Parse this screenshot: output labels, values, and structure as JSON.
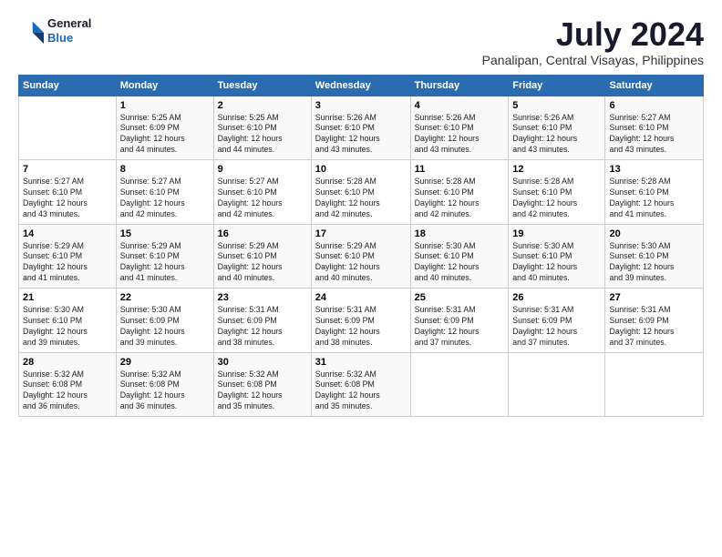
{
  "logo": {
    "line1": "General",
    "line2": "Blue"
  },
  "title": "July 2024",
  "subtitle": "Panalipan, Central Visayas, Philippines",
  "days_of_week": [
    "Sunday",
    "Monday",
    "Tuesday",
    "Wednesday",
    "Thursday",
    "Friday",
    "Saturday"
  ],
  "weeks": [
    [
      {
        "num": "",
        "info": ""
      },
      {
        "num": "1",
        "info": "Sunrise: 5:25 AM\nSunset: 6:09 PM\nDaylight: 12 hours\nand 44 minutes."
      },
      {
        "num": "2",
        "info": "Sunrise: 5:25 AM\nSunset: 6:10 PM\nDaylight: 12 hours\nand 44 minutes."
      },
      {
        "num": "3",
        "info": "Sunrise: 5:26 AM\nSunset: 6:10 PM\nDaylight: 12 hours\nand 43 minutes."
      },
      {
        "num": "4",
        "info": "Sunrise: 5:26 AM\nSunset: 6:10 PM\nDaylight: 12 hours\nand 43 minutes."
      },
      {
        "num": "5",
        "info": "Sunrise: 5:26 AM\nSunset: 6:10 PM\nDaylight: 12 hours\nand 43 minutes."
      },
      {
        "num": "6",
        "info": "Sunrise: 5:27 AM\nSunset: 6:10 PM\nDaylight: 12 hours\nand 43 minutes."
      }
    ],
    [
      {
        "num": "7",
        "info": "Sunrise: 5:27 AM\nSunset: 6:10 PM\nDaylight: 12 hours\nand 43 minutes."
      },
      {
        "num": "8",
        "info": "Sunrise: 5:27 AM\nSunset: 6:10 PM\nDaylight: 12 hours\nand 42 minutes."
      },
      {
        "num": "9",
        "info": "Sunrise: 5:27 AM\nSunset: 6:10 PM\nDaylight: 12 hours\nand 42 minutes."
      },
      {
        "num": "10",
        "info": "Sunrise: 5:28 AM\nSunset: 6:10 PM\nDaylight: 12 hours\nand 42 minutes."
      },
      {
        "num": "11",
        "info": "Sunrise: 5:28 AM\nSunset: 6:10 PM\nDaylight: 12 hours\nand 42 minutes."
      },
      {
        "num": "12",
        "info": "Sunrise: 5:28 AM\nSunset: 6:10 PM\nDaylight: 12 hours\nand 42 minutes."
      },
      {
        "num": "13",
        "info": "Sunrise: 5:28 AM\nSunset: 6:10 PM\nDaylight: 12 hours\nand 41 minutes."
      }
    ],
    [
      {
        "num": "14",
        "info": "Sunrise: 5:29 AM\nSunset: 6:10 PM\nDaylight: 12 hours\nand 41 minutes."
      },
      {
        "num": "15",
        "info": "Sunrise: 5:29 AM\nSunset: 6:10 PM\nDaylight: 12 hours\nand 41 minutes."
      },
      {
        "num": "16",
        "info": "Sunrise: 5:29 AM\nSunset: 6:10 PM\nDaylight: 12 hours\nand 40 minutes."
      },
      {
        "num": "17",
        "info": "Sunrise: 5:29 AM\nSunset: 6:10 PM\nDaylight: 12 hours\nand 40 minutes."
      },
      {
        "num": "18",
        "info": "Sunrise: 5:30 AM\nSunset: 6:10 PM\nDaylight: 12 hours\nand 40 minutes."
      },
      {
        "num": "19",
        "info": "Sunrise: 5:30 AM\nSunset: 6:10 PM\nDaylight: 12 hours\nand 40 minutes."
      },
      {
        "num": "20",
        "info": "Sunrise: 5:30 AM\nSunset: 6:10 PM\nDaylight: 12 hours\nand 39 minutes."
      }
    ],
    [
      {
        "num": "21",
        "info": "Sunrise: 5:30 AM\nSunset: 6:10 PM\nDaylight: 12 hours\nand 39 minutes."
      },
      {
        "num": "22",
        "info": "Sunrise: 5:30 AM\nSunset: 6:09 PM\nDaylight: 12 hours\nand 39 minutes."
      },
      {
        "num": "23",
        "info": "Sunrise: 5:31 AM\nSunset: 6:09 PM\nDaylight: 12 hours\nand 38 minutes."
      },
      {
        "num": "24",
        "info": "Sunrise: 5:31 AM\nSunset: 6:09 PM\nDaylight: 12 hours\nand 38 minutes."
      },
      {
        "num": "25",
        "info": "Sunrise: 5:31 AM\nSunset: 6:09 PM\nDaylight: 12 hours\nand 37 minutes."
      },
      {
        "num": "26",
        "info": "Sunrise: 5:31 AM\nSunset: 6:09 PM\nDaylight: 12 hours\nand 37 minutes."
      },
      {
        "num": "27",
        "info": "Sunrise: 5:31 AM\nSunset: 6:09 PM\nDaylight: 12 hours\nand 37 minutes."
      }
    ],
    [
      {
        "num": "28",
        "info": "Sunrise: 5:32 AM\nSunset: 6:08 PM\nDaylight: 12 hours\nand 36 minutes."
      },
      {
        "num": "29",
        "info": "Sunrise: 5:32 AM\nSunset: 6:08 PM\nDaylight: 12 hours\nand 36 minutes."
      },
      {
        "num": "30",
        "info": "Sunrise: 5:32 AM\nSunset: 6:08 PM\nDaylight: 12 hours\nand 35 minutes."
      },
      {
        "num": "31",
        "info": "Sunrise: 5:32 AM\nSunset: 6:08 PM\nDaylight: 12 hours\nand 35 minutes."
      },
      {
        "num": "",
        "info": ""
      },
      {
        "num": "",
        "info": ""
      },
      {
        "num": "",
        "info": ""
      }
    ]
  ]
}
